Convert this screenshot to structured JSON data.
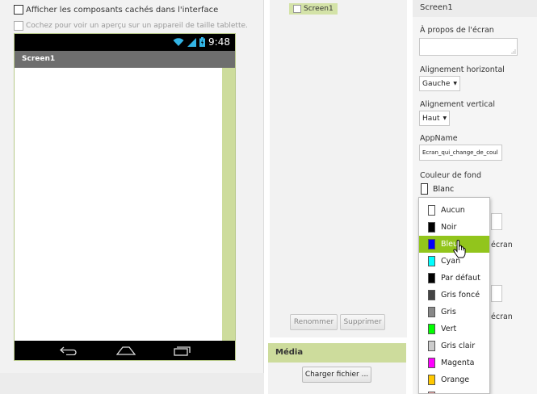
{
  "viewer": {
    "show_hidden_label": "Afficher les composants cachés dans l'interface",
    "tablet_preview_label": "Cochez pour voir un aperçu sur un appareil de taille tablette.",
    "status_time": "9:48",
    "screen_title": "Screen1"
  },
  "components": {
    "tree_item": "Screen1",
    "rename_label": "Renommer",
    "delete_label": "Supprimer"
  },
  "media": {
    "title": "Média",
    "upload_label": "Charger fichier ..."
  },
  "properties": {
    "header": "Screen1",
    "about_label": "À propos de l'écran",
    "align_h_label": "Alignement horizontal",
    "align_h_value": "Gauche",
    "align_v_label": "Alignement vertical",
    "align_v_value": "Haut",
    "appname_label": "AppName",
    "appname_value": "Ecran_qui_change_de_coul",
    "bg_color_label": "Couleur de fond",
    "bg_color_value": "Blanc",
    "hidden_label_1": "écran",
    "hidden_label_2": "écran"
  },
  "color_dropdown": {
    "items": [
      {
        "label": "Aucun",
        "color": "#ffffff"
      },
      {
        "label": "Noir",
        "color": "#000000"
      },
      {
        "label": "Bleu",
        "color": "#0000ff"
      },
      {
        "label": "Cyan",
        "color": "#00ffff"
      },
      {
        "label": "Par défaut",
        "color": "#000000"
      },
      {
        "label": "Gris foncé",
        "color": "#444444"
      },
      {
        "label": "Gris",
        "color": "#888888"
      },
      {
        "label": "Vert",
        "color": "#00ff00"
      },
      {
        "label": "Gris clair",
        "color": "#cccccc"
      },
      {
        "label": "Magenta",
        "color": "#ff00ff"
      },
      {
        "label": "Orange",
        "color": "#ffc800"
      },
      {
        "label": "",
        "color": "#ffafaf"
      }
    ],
    "selected": "Bleu"
  },
  "colors": {
    "accent_green": "#92c51c",
    "panel_green": "#cddc9c",
    "titlebar_gray": "#6e6e6e"
  },
  "icons": [
    "wifi-icon",
    "signal-icon",
    "battery-icon",
    "back-icon",
    "home-icon",
    "recents-icon",
    "screen-icon",
    "hand-cursor-icon"
  ]
}
